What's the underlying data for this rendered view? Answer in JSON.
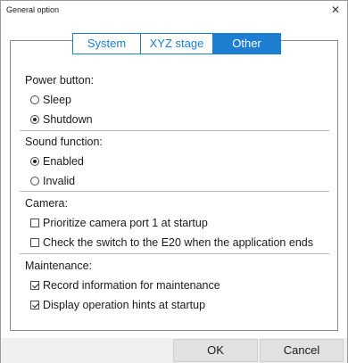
{
  "window": {
    "title": "General option",
    "close_icon": "close-icon"
  },
  "tabs": [
    {
      "label": "System",
      "active": false
    },
    {
      "label": "XYZ stage",
      "active": false
    },
    {
      "label": "Other",
      "active": true
    }
  ],
  "power": {
    "title": "Power button:",
    "options": [
      {
        "label": "Sleep",
        "checked": false
      },
      {
        "label": "Shutdown",
        "checked": true
      }
    ]
  },
  "sound": {
    "title": "Sound function:",
    "options": [
      {
        "label": "Enabled",
        "checked": true
      },
      {
        "label": "Invalid",
        "checked": false
      }
    ]
  },
  "camera": {
    "title": "Camera:",
    "options": [
      {
        "label": "Prioritize camera port 1 at startup",
        "checked": false
      },
      {
        "label": "Check the switch to the E20 when the application ends",
        "checked": false
      }
    ]
  },
  "maintenance": {
    "title": "Maintenance:",
    "options": [
      {
        "label": "Record information for maintenance",
        "checked": true
      },
      {
        "label": "Display operation hints at startup",
        "checked": true
      }
    ]
  },
  "buttons": {
    "ok": "OK",
    "cancel": "Cancel"
  },
  "colors": {
    "accent": "#1e7fd2",
    "border": "#8a8a8a",
    "footer_bg": "#f0f0f0"
  }
}
